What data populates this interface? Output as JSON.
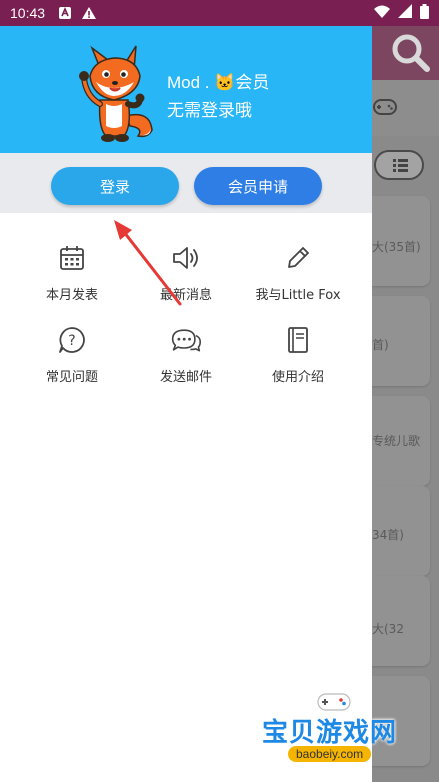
{
  "status_bar": {
    "time": "10:43"
  },
  "header": {
    "user_name": "Mod . 🐱会员",
    "user_subtitle": "无需登录哦"
  },
  "buttons": {
    "login": "登录",
    "member_apply": "会员申请"
  },
  "menu": {
    "monthly_releases": "本月发表",
    "latest_news": "最新消息",
    "me_and_little_fox": "我与Little Fox",
    "faq": "常见问题",
    "send_mail": "发送邮件",
    "user_guide": "使用介绍"
  },
  "background_list": {
    "card1": "大(35首)",
    "card2": "首)",
    "card3": "专统儿歌",
    "card4": "34首)",
    "card5": "大(32"
  },
  "watermark": {
    "text": "宝贝游戏网",
    "url": "baobeiy.com"
  },
  "colors": {
    "header": "#29b6f6",
    "login_button": "#2aa7ea",
    "member_button": "#2e7ee6",
    "annotation_arrow": "#e53935"
  }
}
